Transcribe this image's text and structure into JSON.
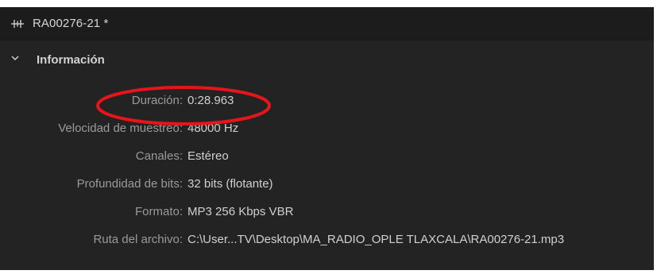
{
  "header": {
    "title": "RA00276-21 *",
    "icon": "audio-waveform-icon"
  },
  "section": {
    "title": "Información",
    "toggle_icon": "chevron-down-icon"
  },
  "rows": [
    {
      "label": "Duración:",
      "value": "0:28.963"
    },
    {
      "label": "Velocidad de muestreo:",
      "value": "48000 Hz"
    },
    {
      "label": "Canales:",
      "value": "Estéreo"
    },
    {
      "label": "Profundidad de bits:",
      "value": "32 bits (flotante)"
    },
    {
      "label": "Formato:",
      "value": "MP3 256 Kbps VBR"
    },
    {
      "label": "Ruta del archivo:",
      "value": "C:\\User...TV\\Desktop\\MA_RADIO_OPLE TLAXCALA\\RA00276-21.mp3"
    }
  ],
  "annotation": {
    "color": "#e8141c"
  }
}
